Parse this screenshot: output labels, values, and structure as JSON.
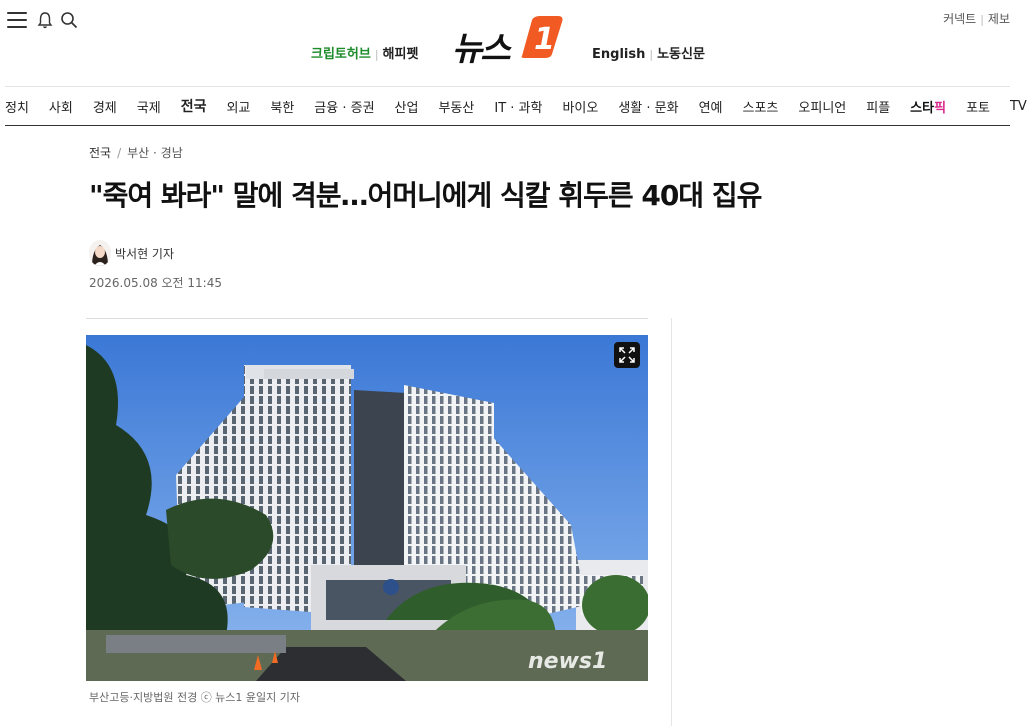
{
  "header": {
    "logo_text": "뉴스",
    "logo_badge": "1",
    "promo_left": [
      "크립토허브",
      "해피펫"
    ],
    "promo_right": [
      "English",
      "노동신문"
    ],
    "top_links": [
      "커넥트",
      "제보"
    ]
  },
  "nav": {
    "items": [
      "정치",
      "사회",
      "경제",
      "국제",
      "전국",
      "외교",
      "북한",
      "금융 · 증권",
      "산업",
      "부동산",
      "IT · 과학",
      "바이오",
      "생활 · 문화",
      "연예",
      "스포츠",
      "오피니언",
      "피플"
    ],
    "star_item": {
      "main": "스타",
      "pink": "픽"
    },
    "tail_items": [
      "포토",
      "TV"
    ],
    "active": "전국"
  },
  "article": {
    "breadcrumb_section": "전국",
    "breadcrumb_sub": "부산 · 경남",
    "headline": "\"죽여 봐라\" 말에 격분…어머니에게 식칼 휘두른 40대 집유",
    "author": "박서현 기자",
    "date": "2026.05.08 오전 11:45",
    "caption": "부산고등·지방법원 전경 ⓒ 뉴스1 윤일지 기자",
    "photo_watermark": "news1"
  },
  "colors": {
    "brand_orange": "#f15a22",
    "promo_green": "#1f8c2c",
    "star_pink": "#d9288b"
  }
}
